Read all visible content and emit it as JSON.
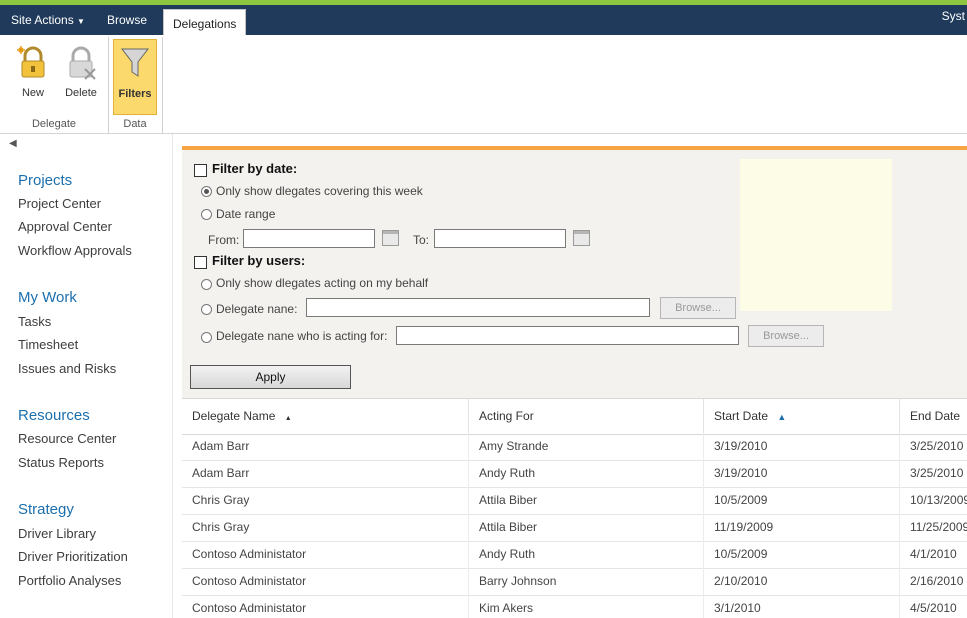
{
  "ribbon_tabs": {
    "site_actions": "Site Actions",
    "browse": "Browse",
    "delegations": "Delegations",
    "user": "Syst"
  },
  "ribbon": {
    "new_label": "New",
    "delete_label": "Delete",
    "filters_label": "Filters",
    "group_delegate": "Delegate",
    "group_data": "Data"
  },
  "nav": {
    "sections": [
      {
        "header": "Projects",
        "items": [
          "Project Center",
          "Approval Center",
          "Workflow Approvals"
        ]
      },
      {
        "header": "My Work",
        "items": [
          "Tasks",
          "Timesheet",
          "Issues and Risks"
        ]
      },
      {
        "header": "Resources",
        "items": [
          "Resource Center",
          "Status Reports"
        ]
      },
      {
        "header": "Strategy",
        "items": [
          "Driver Library",
          "Driver Prioritization",
          "Portfolio Analyses"
        ]
      }
    ]
  },
  "filter": {
    "by_date": "Filter by date:",
    "this_week": "Only show dlegates covering this week",
    "date_range": "Date range",
    "from": "From:",
    "to": "To:",
    "by_users": "Filter by users:",
    "my_behalf": "Only show dlegates acting on my behalf",
    "delegate_name": "Delegate nane:",
    "acting_for": "Delegate nane who is acting for:",
    "browse": "Browse...",
    "apply": "Apply"
  },
  "grid": {
    "columns": [
      "Delegate Name",
      "Acting For",
      "Start Date",
      "End Date"
    ],
    "rows": [
      [
        "Adam Barr",
        "Amy Strande",
        "3/19/2010",
        "3/25/2010"
      ],
      [
        "Adam Barr",
        "Andy Ruth",
        "3/19/2010",
        "3/25/2010"
      ],
      [
        "Chris Gray",
        "Attila Biber",
        "10/5/2009",
        "10/13/2009"
      ],
      [
        "Chris Gray",
        "Attila Biber",
        "11/19/2009",
        "11/25/2009"
      ],
      [
        "Contoso Administator",
        "Andy Ruth",
        "10/5/2009",
        "4/1/2010"
      ],
      [
        "Contoso Administator",
        "Barry Johnson",
        "2/10/2010",
        "2/16/2010"
      ],
      [
        "Contoso Administator",
        "Kim Akers",
        "3/1/2010",
        "4/5/2010"
      ]
    ]
  },
  "colors": {
    "ribbon_bar": "#1f3a5a",
    "accent_orange": "#f7a543",
    "nav_header": "#1c6fad",
    "selected_button": "#fbd96d"
  }
}
